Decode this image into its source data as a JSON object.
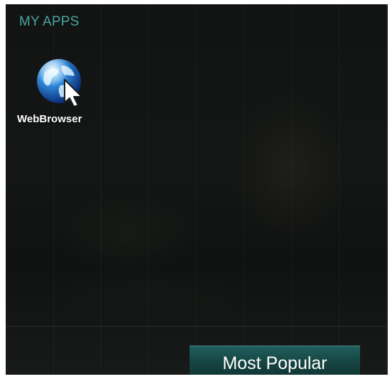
{
  "header": {
    "section_title": "MY APPS"
  },
  "apps": [
    {
      "label": "WebBrowser",
      "icon": "globe-cursor-icon"
    }
  ],
  "bottom_tab": {
    "label": "Most Popular"
  },
  "colors": {
    "accent": "#4aa3a0",
    "tab_background": "#15423f",
    "text": "#ffffff",
    "screen_background": "#121514"
  }
}
